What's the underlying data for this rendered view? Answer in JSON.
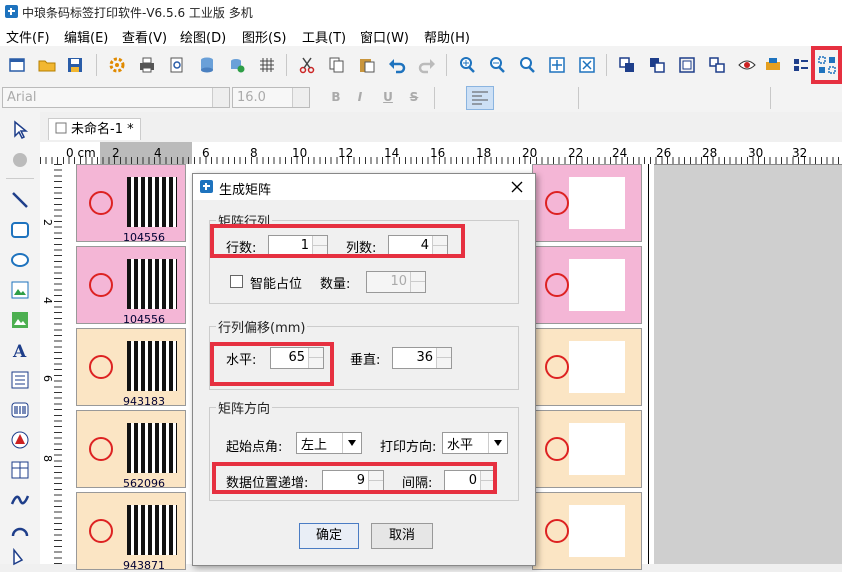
{
  "app": {
    "title": "中琅条码标签打印软件-V6.5.6 工业版 多机"
  },
  "menu": [
    {
      "label": "文件(F)"
    },
    {
      "label": "编辑(E)"
    },
    {
      "label": "查看(V)"
    },
    {
      "label": "绘图(D)"
    },
    {
      "label": "图形(S)"
    },
    {
      "label": "工具(T)"
    },
    {
      "label": "窗口(W)"
    },
    {
      "label": "帮助(H)"
    }
  ],
  "format_bar": {
    "font_name": "Arial",
    "font_size": "16.0",
    "bold": "B",
    "italic": "I",
    "underline": "U",
    "strike": "S"
  },
  "document_tab": "未命名-1 *",
  "ruler": {
    "unit_label": "0 cm",
    "ticks": [
      "2",
      "4",
      "6",
      "8",
      "10",
      "12",
      "14",
      "16",
      "18",
      "20",
      "22",
      "24",
      "26",
      "28",
      "30",
      "32"
    ],
    "v_ticks": [
      "2",
      "4",
      "6",
      "8"
    ]
  },
  "labels": {
    "col1_numbers": [
      "104556",
      "104556",
      "943183",
      "562096",
      "943871"
    ]
  },
  "dialog": {
    "title": "生成矩阵",
    "matrix_group": {
      "title": "矩阵行列",
      "rows_label": "行数:",
      "rows_value": "1",
      "cols_label": "列数:",
      "cols_value": "4",
      "smart_label": "智能占位",
      "qty_label": "数量:",
      "qty_value": "10"
    },
    "offset_group": {
      "title": "行列偏移(mm)",
      "h_label": "水平:",
      "h_value": "65",
      "v_label": "垂直:",
      "v_value": "36"
    },
    "direction_group": {
      "title": "矩阵方向",
      "start_label": "起始点角:",
      "start_value": "左上",
      "print_label": "打印方向:",
      "print_value": "水平",
      "incr_label": "数据位置递增:",
      "incr_value": "9",
      "gap_label": "间隔:",
      "gap_value": "0"
    },
    "ok_label": "确定",
    "cancel_label": "取消"
  },
  "colors": {
    "highlight": "#e63040",
    "label_pink": "#f4b6d6",
    "label_beige": "#fbe5c4",
    "accent_blue": "#1e73be"
  }
}
